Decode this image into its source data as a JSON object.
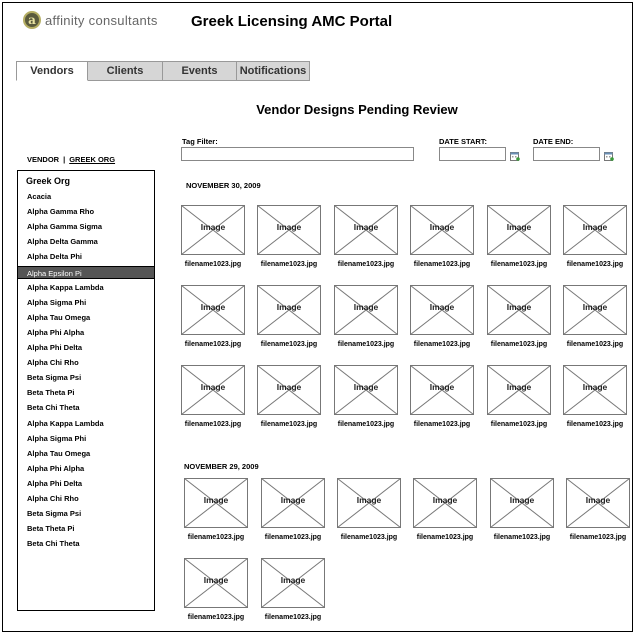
{
  "brand": {
    "name": "affinity consultants",
    "mark": "a"
  },
  "header": {
    "title": "Greek Licensing AMC Portal"
  },
  "tabs": [
    {
      "label": "Vendors",
      "active": true
    },
    {
      "label": "Clients",
      "active": false
    },
    {
      "label": "Events",
      "active": false
    },
    {
      "label": "Notifications",
      "active": false
    }
  ],
  "main": {
    "title": "Vendor Designs Pending Review"
  },
  "toggle": {
    "vendor": "VENDOR",
    "separator": "|",
    "greek_org": "GREEK ORG"
  },
  "org_list": {
    "heading": "Greek Org",
    "selected_index": 5,
    "items": [
      "Acacia",
      "Alpha Gamma Rho",
      "Alpha Gamma Sigma",
      "Alpha Delta Gamma",
      "Alpha Delta Phi",
      "Alpha Epsilon Pi",
      "Alpha Kappa Lambda",
      "Alpha Sigma Phi",
      "Alpha Tau Omega",
      "Alpha Phi Alpha",
      "Alpha Phi Delta",
      "Alpha Chi Rho",
      "Beta Sigma Psi",
      "Beta Theta Pi",
      "Beta Chi Theta",
      "Alpha Kappa Lambda",
      "Alpha Sigma Phi",
      "Alpha Tau Omega",
      "Alpha Phi Alpha",
      "Alpha Phi Delta",
      "Alpha Chi Rho",
      "Beta Sigma Psi",
      "Beta Theta Pi",
      "Beta Chi Theta"
    ]
  },
  "filters": {
    "tag_label": "Tag Filter:",
    "tag_value": "",
    "date_start_label": "DATE START:",
    "date_start_value": "",
    "date_end_label": "DATE END:",
    "date_end_value": ""
  },
  "groups": [
    {
      "date": "NOVEMBER 30, 2009",
      "items": [
        {
          "placeholder": "Image",
          "filename": "filename1023.jpg"
        },
        {
          "placeholder": "Image",
          "filename": "filename1023.jpg"
        },
        {
          "placeholder": "Image",
          "filename": "filename1023.jpg"
        },
        {
          "placeholder": "Image",
          "filename": "filename1023.jpg"
        },
        {
          "placeholder": "Image",
          "filename": "filename1023.jpg"
        },
        {
          "placeholder": "Image",
          "filename": "filename1023.jpg"
        },
        {
          "placeholder": "Image",
          "filename": "filename1023.jpg"
        },
        {
          "placeholder": "Image",
          "filename": "filename1023.jpg"
        },
        {
          "placeholder": "Image",
          "filename": "filename1023.jpg"
        },
        {
          "placeholder": "Image",
          "filename": "filename1023.jpg"
        },
        {
          "placeholder": "Image",
          "filename": "filename1023.jpg"
        },
        {
          "placeholder": "Image",
          "filename": "filename1023.jpg"
        },
        {
          "placeholder": "Image",
          "filename": "filename1023.jpg"
        },
        {
          "placeholder": "Image",
          "filename": "filename1023.jpg"
        },
        {
          "placeholder": "Image",
          "filename": "filename1023.jpg"
        },
        {
          "placeholder": "Image",
          "filename": "filename1023.jpg"
        },
        {
          "placeholder": "Image",
          "filename": "filename1023.jpg"
        },
        {
          "placeholder": "Image",
          "filename": "filename1023.jpg"
        }
      ]
    },
    {
      "date": "NOVEMBER 29, 2009",
      "items": [
        {
          "placeholder": "Image",
          "filename": "filename1023.jpg"
        },
        {
          "placeholder": "Image",
          "filename": "filename1023.jpg"
        },
        {
          "placeholder": "Image",
          "filename": "filename1023.jpg"
        },
        {
          "placeholder": "Image",
          "filename": "filename1023.jpg"
        },
        {
          "placeholder": "Image",
          "filename": "filename1023.jpg"
        },
        {
          "placeholder": "Image",
          "filename": "filename1023.jpg"
        },
        {
          "placeholder": "Image",
          "filename": "filename1023.jpg"
        },
        {
          "placeholder": "Image",
          "filename": "filename1023.jpg"
        }
      ]
    }
  ]
}
